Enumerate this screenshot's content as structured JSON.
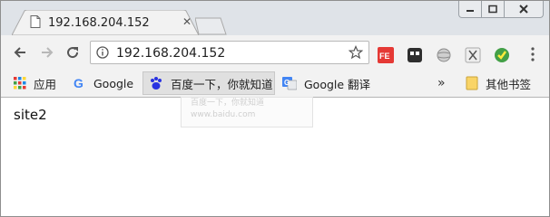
{
  "tab": {
    "title": "192.168.204.152",
    "favicon": "page-icon"
  },
  "omnibox": {
    "url": "192.168.204.152"
  },
  "bookmarks": [
    {
      "label": "应用",
      "icon": "apps-grid-icon"
    },
    {
      "label": "Google",
      "icon": "google-icon"
    },
    {
      "label": "百度一下，你就知道",
      "icon": "baidu-paw-icon"
    },
    {
      "label": "Google 翻译",
      "icon": "google-translate-icon"
    },
    {
      "label": "其他书签",
      "icon": "folder-icon"
    }
  ],
  "ghost_tooltip": {
    "line1": "百度一下，你就知道",
    "line2": "www.baidu.com"
  },
  "page": {
    "text": "site2"
  },
  "colors": {
    "chrome_bg": "#f2f2f2",
    "tabstrip_bg": "#dfe3e8",
    "accent_red": "#e53935"
  }
}
